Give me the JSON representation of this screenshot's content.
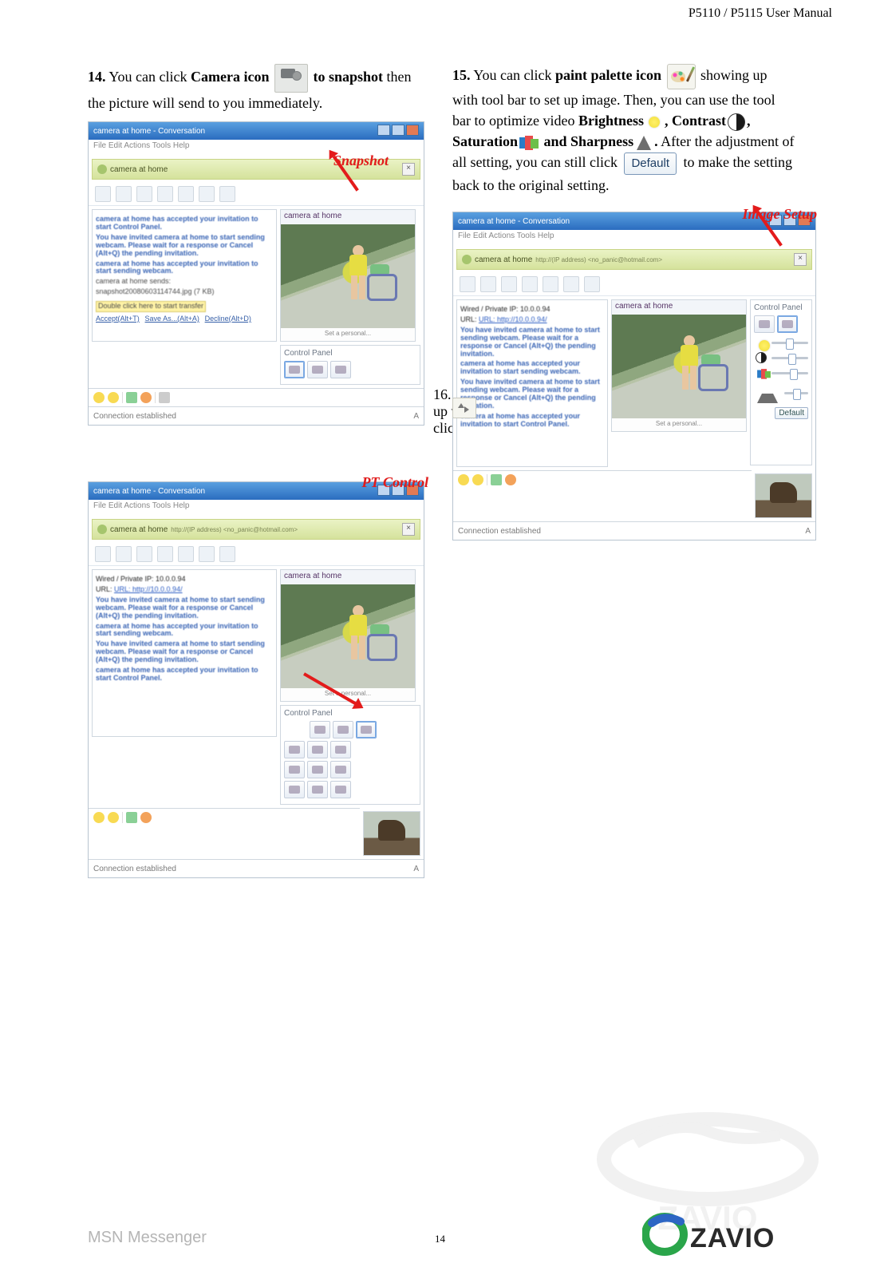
{
  "header": {
    "manual_title": "P5110 / P5115 User Manual"
  },
  "step14": {
    "num": "14.",
    "pre": "You can click ",
    "camera_icon_b": "Camera icon ",
    "to_snapshot_b": " to snapshot",
    "post": " then the picture will send to you immediately.",
    "callout": "Snapshot"
  },
  "step15": {
    "num": "15.",
    "pre": "You can click ",
    "palette_b": "paint palette icon",
    "line2a": " showing up with tool bar to set up image. Then, you can use the tool bar to optimize video ",
    "brightness_b": "Brightness",
    "comma1": ", ",
    "contrast_b": "Contrast",
    "comma2": ", ",
    "sat_b": "Saturation",
    "and": " and ",
    "sharp_b": "Sharpness",
    "dot": ".",
    "after": "    After the adjustment of all setting, you can still click ",
    "default_btn": "Default",
    "tail": " to make the setting back to the original setting.",
    "callout": "Image Setup"
  },
  "step16": {
    "num": "16.",
    "up": "up w",
    "click": "clic",
    "callout": "PT Control"
  },
  "messenger": {
    "title": "camera at home - Conversation",
    "menubar": "File  Edit  Actions  Tools  Help",
    "contactbar": "camera at home",
    "contactbar_sub": "http://(IP address) <no_panic@hotmail.com>",
    "url_label": "Wired / Private IP: 10.0.0.94",
    "url_link": "URL: http://10.0.0.94/",
    "invite_line1": "camera at home has accepted your invitation to start Control Panel.",
    "invite_line2": "You have invited camera at home to start sending webcam. Please wait for a response or Cancel (Alt+Q) the pending invitation.",
    "invite_line3": "camera at home has accepted your invitation to start sending webcam.",
    "invite_line4": "camera at home sends:",
    "file_line": "snapshot20080603114744.jpg (7 KB)",
    "file_warn": "Double click here to start transfer",
    "accept": "Accept(Alt+T)",
    "saveas": "Save As...(Alt+A)",
    "decline": "Decline(Alt+D)",
    "video_title": "camera at home",
    "video_foot": "Set a personal...",
    "status": "Connection established",
    "status_right": "A",
    "cp_title": "Control Panel",
    "cp_default": "Default"
  },
  "footer": {
    "brand": "MSN Messenger",
    "page": "14",
    "logo_text": "ZAVIO"
  }
}
